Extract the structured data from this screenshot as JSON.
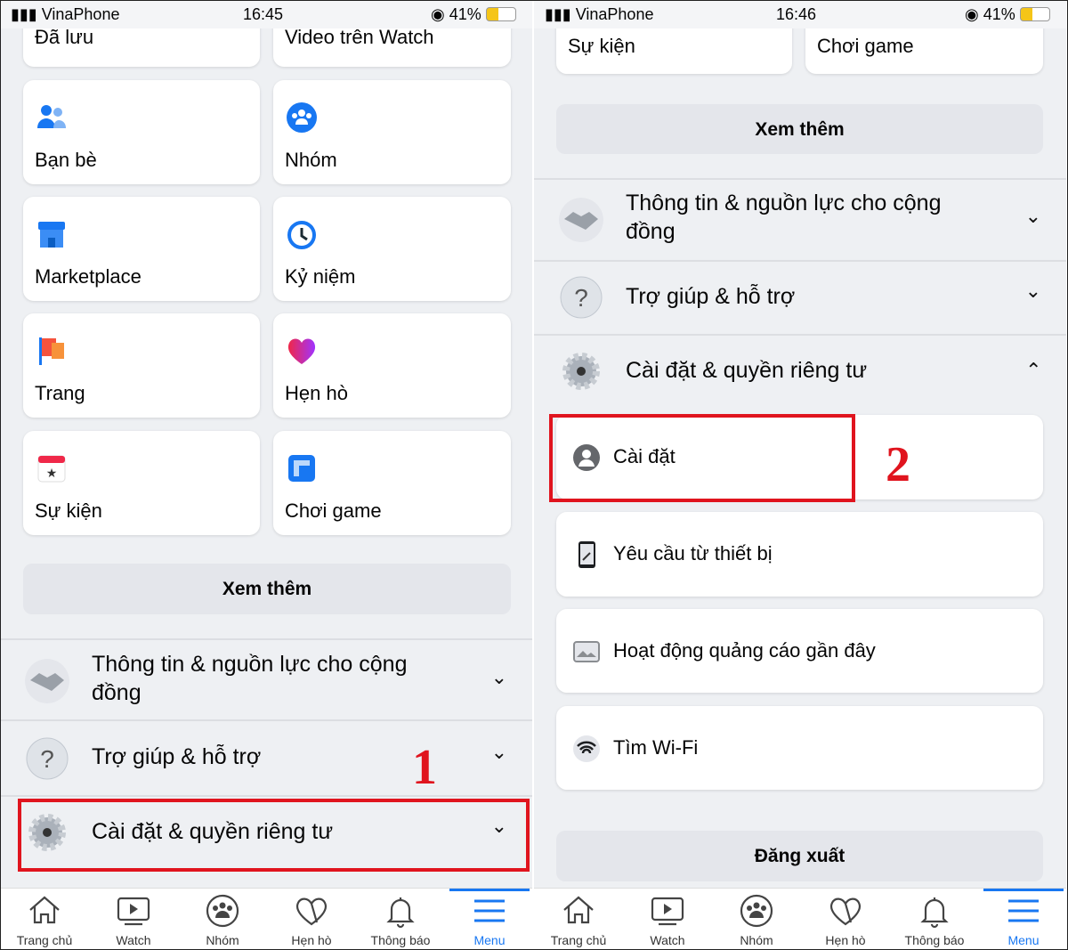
{
  "left": {
    "status": {
      "carrier": "VinaPhone",
      "time": "16:45",
      "battery": "41%"
    },
    "cards": [
      {
        "label": "Đã lưu",
        "icon": "bookmark-icon"
      },
      {
        "label": "Video trên Watch",
        "icon": "video-icon"
      },
      {
        "label": "Bạn bè",
        "icon": "friends-icon"
      },
      {
        "label": "Nhóm",
        "icon": "groups-icon"
      },
      {
        "label": "Marketplace",
        "icon": "marketplace-icon"
      },
      {
        "label": "Kỷ niệm",
        "icon": "memories-icon"
      },
      {
        "label": "Trang",
        "icon": "flag-icon"
      },
      {
        "label": "Hẹn hò",
        "icon": "heart-icon"
      },
      {
        "label": "Sự kiện",
        "icon": "calendar-icon"
      },
      {
        "label": "Chơi game",
        "icon": "gaming-icon"
      }
    ],
    "see_more": "Xem thêm",
    "sections": [
      {
        "line1": "Thông tin & nguồn lực cho cộng",
        "line2": "đồng",
        "chevron": "chevron-down"
      },
      {
        "line1": "Trợ giúp & hỗ trợ",
        "chevron": "chevron-down"
      },
      {
        "line1": "Cài đặt & quyền riêng tư",
        "chevron": "chevron-down"
      }
    ],
    "annotation": "1"
  },
  "right": {
    "status": {
      "carrier": "VinaPhone",
      "time": "16:46",
      "battery": "41%"
    },
    "cards": [
      {
        "label": "Sự kiện"
      },
      {
        "label": "Chơi game"
      }
    ],
    "see_more": "Xem thêm",
    "sections": [
      {
        "line1": "Thông tin & nguồn lực cho cộng",
        "line2": "đồng",
        "chevron": "chevron-down"
      },
      {
        "line1": "Trợ giúp & hỗ trợ",
        "chevron": "chevron-down"
      },
      {
        "line1": "Cài đặt & quyền riêng tư",
        "chevron": "chevron-up"
      }
    ],
    "sub_items": [
      {
        "label": "Cài đặt",
        "icon": "profile-icon"
      },
      {
        "label": "Yêu cầu từ thiết bị",
        "icon": "device-icon"
      },
      {
        "label": "Hoạt động quảng cáo gần đây",
        "icon": "ad-icon"
      },
      {
        "label": "Tìm Wi-Fi",
        "icon": "wifi-icon"
      }
    ],
    "logout": "Đăng xuất",
    "annotation": "2"
  },
  "tabbar": [
    {
      "label": "Trang chủ"
    },
    {
      "label": "Watch"
    },
    {
      "label": "Nhóm"
    },
    {
      "label": "Hẹn hò"
    },
    {
      "label": "Thông báo"
    },
    {
      "label": "Menu",
      "active": true
    }
  ],
  "colors": {
    "accent": "#1877f2",
    "highlight": "#e0141e",
    "background": "#eef0f3"
  }
}
